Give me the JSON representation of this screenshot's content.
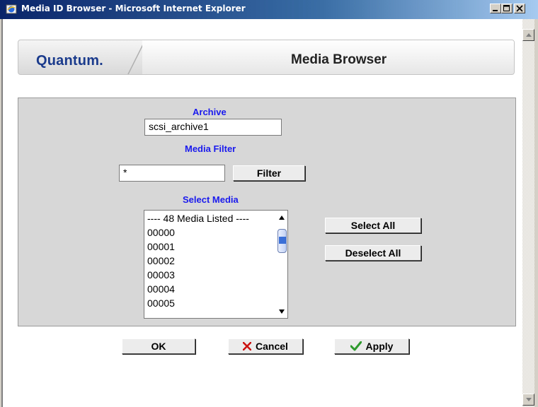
{
  "window": {
    "title": "Media ID Browser - Microsoft Internet Explorer"
  },
  "banner": {
    "logo": "Quantum.",
    "title": "Media Browser"
  },
  "form": {
    "archive_label": "Archive",
    "archive_value": "scsi_archive1",
    "media_filter_label": "Media Filter",
    "media_filter_value": "*",
    "filter_button": "Filter",
    "select_media_label": "Select Media",
    "media_list": [
      "---- 48 Media Listed ----",
      "00000",
      "00001",
      "00002",
      "00003",
      "00004",
      "00005"
    ],
    "select_all_button": "Select All",
    "deselect_all_button": "Deselect All"
  },
  "actions": {
    "ok": "OK",
    "cancel": "Cancel",
    "apply": "Apply"
  },
  "colors": {
    "label_blue": "#1a1aee",
    "cancel_x": "#cc1111",
    "apply_check": "#2e9a2e",
    "brand": "#1a3a8c"
  },
  "icons": [
    "ie-icon",
    "minimize-icon",
    "maximize-icon",
    "close-icon",
    "scroll-up-icon",
    "scroll-down-icon",
    "cancel-x-icon",
    "checkmark-icon"
  ]
}
